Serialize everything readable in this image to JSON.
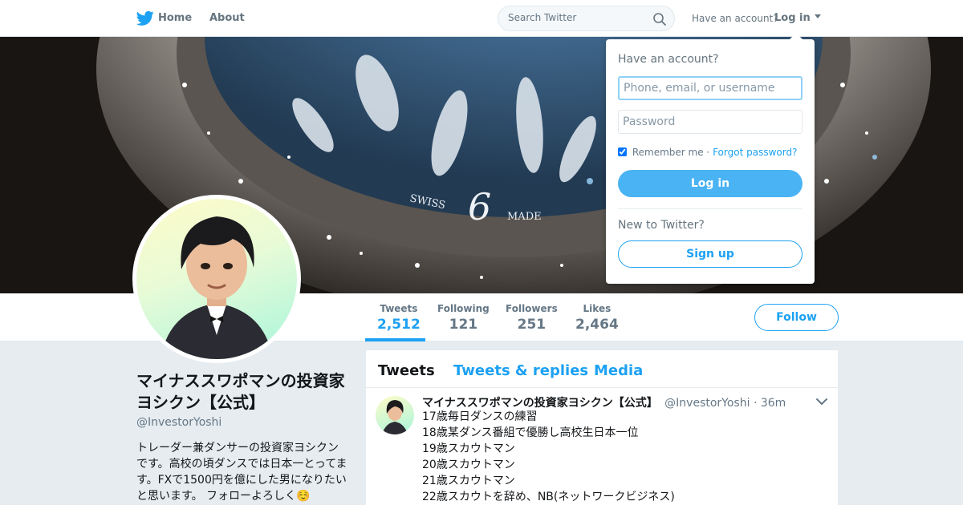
{
  "nav": {
    "home_label": "Home",
    "about_label": "About",
    "search_placeholder": "Search Twitter",
    "have_account": "Have an account?",
    "login_label": "Log in"
  },
  "banner": {
    "watch_text_left": "SWISS",
    "watch_text_right": "MADE",
    "watch_numeral": "6"
  },
  "stats": [
    {
      "label": "Tweets",
      "value": "2,512"
    },
    {
      "label": "Following",
      "value": "121"
    },
    {
      "label": "Followers",
      "value": "251"
    },
    {
      "label": "Likes",
      "value": "2,464"
    }
  ],
  "follow_label": "Follow",
  "profile": {
    "name": "マイナススワポマンの投資家ヨシクン【公式】",
    "handle": "@InvestorYoshi",
    "bio": "トレーダー兼ダンサーの投資家ヨシクンです。高校の頃ダンスでは日本一とってます。FXで1500円を億にした男になりたいと思います。 フォローよろしく☺️"
  },
  "timeline": {
    "tabs": [
      "Tweets",
      "Tweets & replies",
      "Media"
    ],
    "tweet": {
      "name": "マイナススワポマンの投資家ヨシクン【公式】",
      "handle": "@InvestorYoshi",
      "time": "· 36m",
      "lines": [
        "17歳毎日ダンスの練習",
        "18歳某ダンス番組で優勝し高校生日本一位",
        "19歳スカウトマン",
        "20歳スカウトマン",
        "21歳スカウトマン",
        "22歳スカウトを辞め、NB(ネットワークビジネス)"
      ]
    }
  },
  "login_dropdown": {
    "title": "Have an account?",
    "username_placeholder": "Phone, email, or username",
    "password_placeholder": "Password",
    "remember_label": "Remember me",
    "separator": "·",
    "forgot_label": "Forgot password?",
    "login_button": "Log in",
    "new_to_twitter": "New to Twitter?",
    "signup_button": "Sign up"
  },
  "colors": {
    "brand_blue": "#1da1f2",
    "login_button_blue": "#4ab3f4",
    "background": "#e6ecf0"
  }
}
